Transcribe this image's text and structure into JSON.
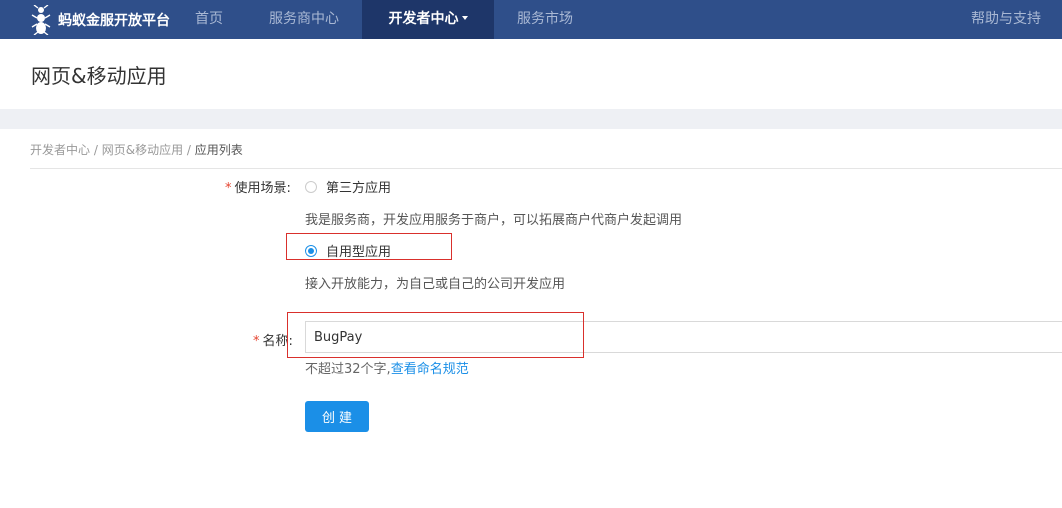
{
  "topnav": {
    "logo_text": "蚂蚁金服开放平台",
    "items": [
      {
        "label": "首页"
      },
      {
        "label": "服务商中心"
      },
      {
        "label": "开发者中心"
      },
      {
        "label": "服务市场"
      }
    ],
    "help": "帮助与支持",
    "active_bg": "#1e3669",
    "bar_bg": "#2f4f8a"
  },
  "page": {
    "title": "网页&移动应用"
  },
  "breadcrumb": {
    "items": [
      "开发者中心",
      "网页&移动应用",
      "应用列表"
    ],
    "separator": "/"
  },
  "form": {
    "required_mark": "*",
    "scene": {
      "label": "使用场景",
      "colon": ":",
      "options": [
        {
          "label": "第三方应用",
          "desc": "我是服务商，开发应用服务于商户，可以拓展商户代商户发起调用",
          "checked": false
        },
        {
          "label": "自用型应用",
          "desc": "接入开放能力，为自己或自己的公司开发应用",
          "checked": true
        }
      ]
    },
    "name": {
      "label": "名称",
      "colon": ":",
      "value": "BugPay",
      "hint": "不超过32个字,",
      "hint_link": "查看命名规范"
    },
    "submit_label": "创建"
  },
  "colors": {
    "accent": "#1b8fe7",
    "required": "#e5432f",
    "highlight": "#d9302c"
  }
}
